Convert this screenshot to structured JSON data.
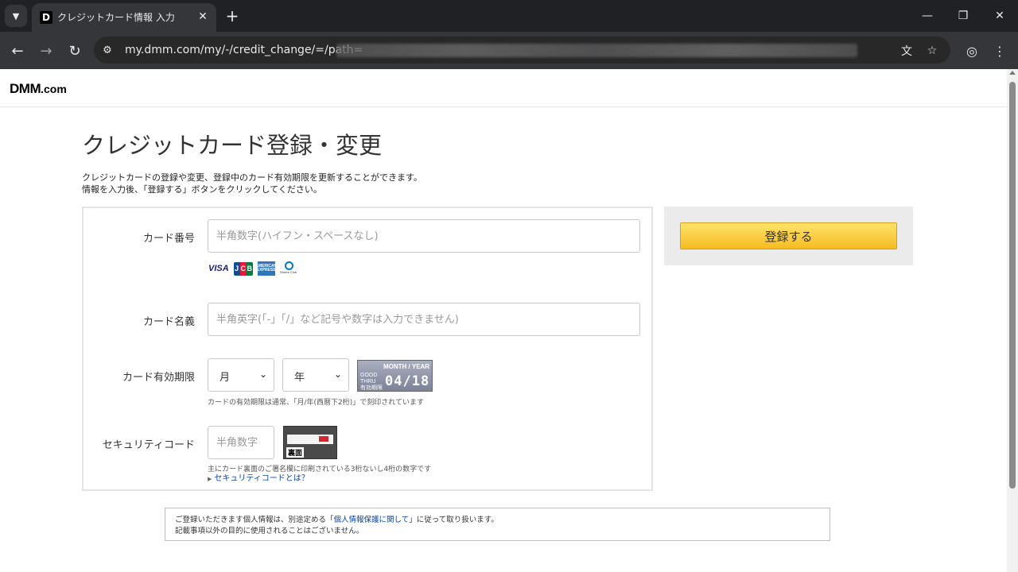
{
  "browser": {
    "tab_title": "クレジットカード情報 入力",
    "tab_favicon_letter": "D",
    "url_text": "my.dmm.com/my/-/credit_change/=/path="
  },
  "header": {
    "logo_main": "DMM",
    "logo_suffix": ".com"
  },
  "page": {
    "title": "クレジットカード登録・変更",
    "lead_line1": "クレジットカードの登録や変更、登録中のカード有効期限を更新することができます。",
    "lead_line2": "情報を入力後、「登録する」ボタンをクリックしてください。"
  },
  "form": {
    "card_number": {
      "label": "カード番号",
      "placeholder": "半角数字(ハイフン・スペースなし)",
      "value": ""
    },
    "brands": {
      "visa": "VISA",
      "jcb": [
        "J",
        "C",
        "B"
      ],
      "amex": "AMERICAN EXPRESS",
      "diners": "Diners Club"
    },
    "card_name": {
      "label": "カード名義",
      "placeholder": "半角英字(「-」「/」など記号や数字は入力できません)",
      "value": ""
    },
    "expiry": {
      "label": "カード有効期限",
      "month_selected": "月",
      "year_selected": "年",
      "sample_header": "MONTH / YEAR",
      "sample_good": "GOOD",
      "sample_thru": "THRU",
      "sample_yuko": "有効期限",
      "sample_date": "04/18",
      "hint": "カードの有効期限は通常、「月/年(西暦下2桁)」で刻印されています"
    },
    "security": {
      "label": "セキュリティコード",
      "placeholder": "半角数字",
      "value": "",
      "card_back_label": "裏面",
      "hint": "主にカード裏面のご署名欄に印刷されている3桁ないし4桁の数字です",
      "link": "セキュリティコードとは？"
    }
  },
  "side": {
    "submit_label": "登録する"
  },
  "privacy": {
    "line1_before": "ご登録いただきます個人情報は、別途定める「",
    "line1_link": "個人情報保護に関して",
    "line1_after": "」に従って取り扱います。",
    "line2": "記載事項以外の目的に使用されることはございません。"
  },
  "colors": {
    "chrome_dark": "#202124",
    "chrome_toolbar": "#35363a",
    "button_yellow": "#f7bb21",
    "link_blue": "#0645ad"
  }
}
